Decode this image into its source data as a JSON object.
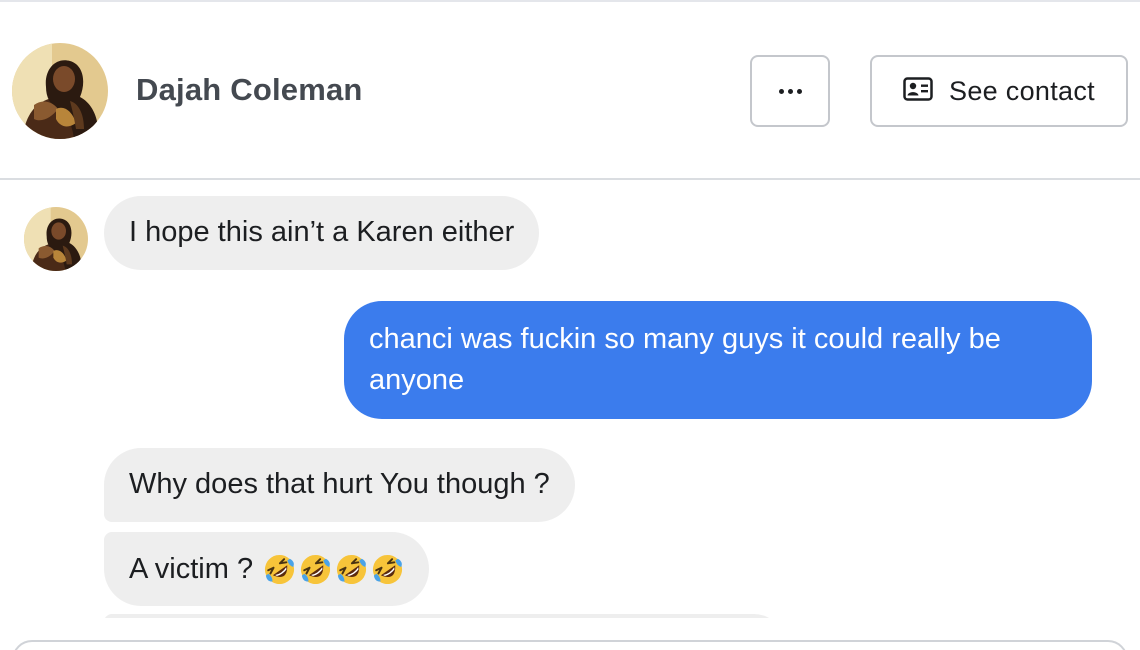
{
  "header": {
    "contact_name": "Dajah Coleman",
    "more_icon": "more-horizontal-icon",
    "see_contact_label": "See contact",
    "contact_card_icon": "contact-card-icon"
  },
  "messages": [
    {
      "direction": "incoming",
      "text": "I hope this ain’t a Karen either"
    },
    {
      "direction": "outgoing",
      "text": "chanci was fuckin so many guys it could really be anyone"
    },
    {
      "direction": "incoming",
      "text": "Why does that hurt You though ?"
    },
    {
      "direction": "incoming",
      "text": "A victim ?",
      "emoji": [
        "rolling-on-floor-laughing",
        "rolling-on-floor-laughing",
        "rolling-on-floor-laughing",
        "rolling-on-floor-laughing"
      ]
    }
  ],
  "colors": {
    "outgoing_bubble": "#3b7ced",
    "incoming_bubble": "#eeeeee"
  }
}
